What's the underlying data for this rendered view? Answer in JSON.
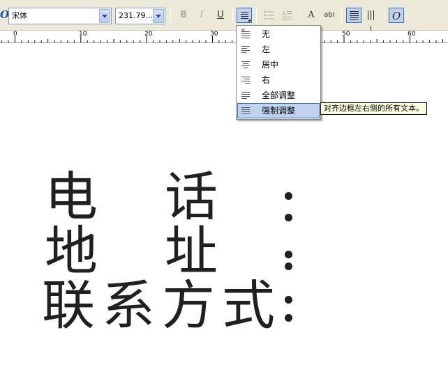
{
  "toolbar": {
    "font_name": "宋体",
    "font_size": "231.79...",
    "bold_label": "B",
    "italic_label": "I",
    "underline_label": "U",
    "align_mode_label": "强制调整",
    "text_frame_label": "A",
    "abc_label": "abI",
    "o_label": "O"
  },
  "ruler": {
    "labels": [
      "0",
      "10",
      "20",
      "30",
      "50",
      "60"
    ]
  },
  "canvas": {
    "line1": [
      "电",
      "话"
    ],
    "line2": [
      "地",
      "址"
    ],
    "line3": [
      "联",
      "系",
      "方",
      "式"
    ]
  },
  "align_menu": {
    "items": [
      {
        "label": "无",
        "icon": "align-none-icon"
      },
      {
        "label": "左",
        "icon": "align-left-icon"
      },
      {
        "label": "居中",
        "icon": "align-center-icon"
      },
      {
        "label": "右",
        "icon": "align-right-icon"
      },
      {
        "label": "全部调整",
        "icon": "justify-full-icon"
      },
      {
        "label": "强制调整",
        "icon": "force-justify-icon"
      }
    ],
    "selected_index": 5,
    "tooltip": "对齐边框左右侧的所有文本。"
  },
  "colors": {
    "toolbar_bg": "#ece9d8",
    "selection": "#c1d2ee",
    "selection_border": "#316ac5",
    "text": "#231f20",
    "tooltip_bg": "#ffffe1"
  }
}
